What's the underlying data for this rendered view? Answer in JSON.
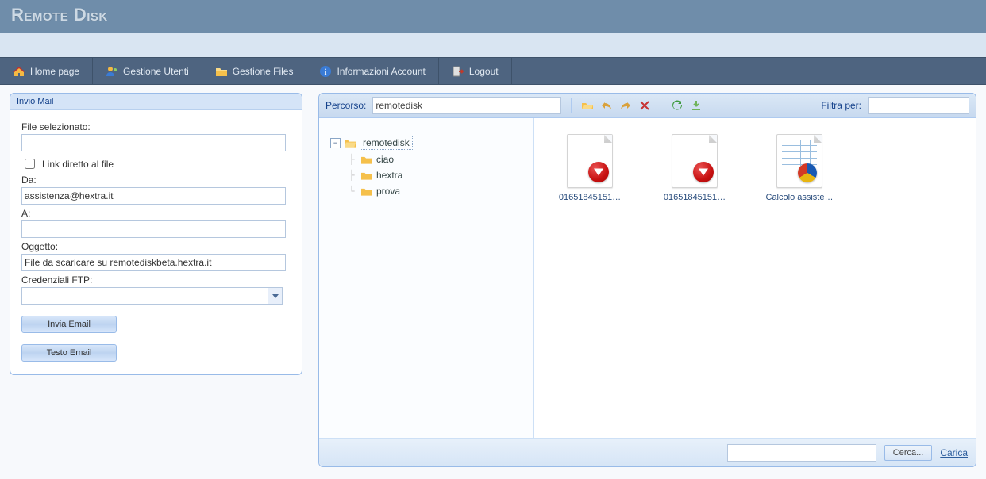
{
  "app_title": "Remote Disk",
  "nav": {
    "home": "Home page",
    "users": "Gestione Utenti",
    "files": "Gestione Files",
    "account": "Informazioni Account",
    "logout": "Logout"
  },
  "mail_panel": {
    "title": "Invio Mail",
    "file_selected_label": "File selezionato:",
    "file_selected": "",
    "direct_link_label": "Link diretto al file",
    "direct_link_checked": false,
    "from_label": "Da:",
    "from": "assistenza@hextra.it",
    "to_label": "A:",
    "to": "",
    "subject_label": "Oggetto:",
    "subject": "File da scaricare su remotediskbeta.hextra.it",
    "ftp_label": "Credenziali FTP:",
    "ftp_value": "",
    "btn_send": "Invia Email",
    "btn_text": "Testo Email"
  },
  "browser": {
    "path_label": "Percorso:",
    "path": "remotedisk",
    "filter_label": "Filtra per:",
    "filter": "",
    "tree": {
      "root": "remotedisk",
      "children": [
        "ciao",
        "hextra",
        "prova"
      ]
    },
    "files": [
      {
        "type": "pdf",
        "name": "01651845151…"
      },
      {
        "type": "pdf",
        "name": "01651845151…"
      },
      {
        "type": "xls",
        "name": "Calcolo assiste…"
      }
    ],
    "footer": {
      "search_value": "",
      "btn_search": "Cerca...",
      "link_upload": "Carica"
    }
  }
}
